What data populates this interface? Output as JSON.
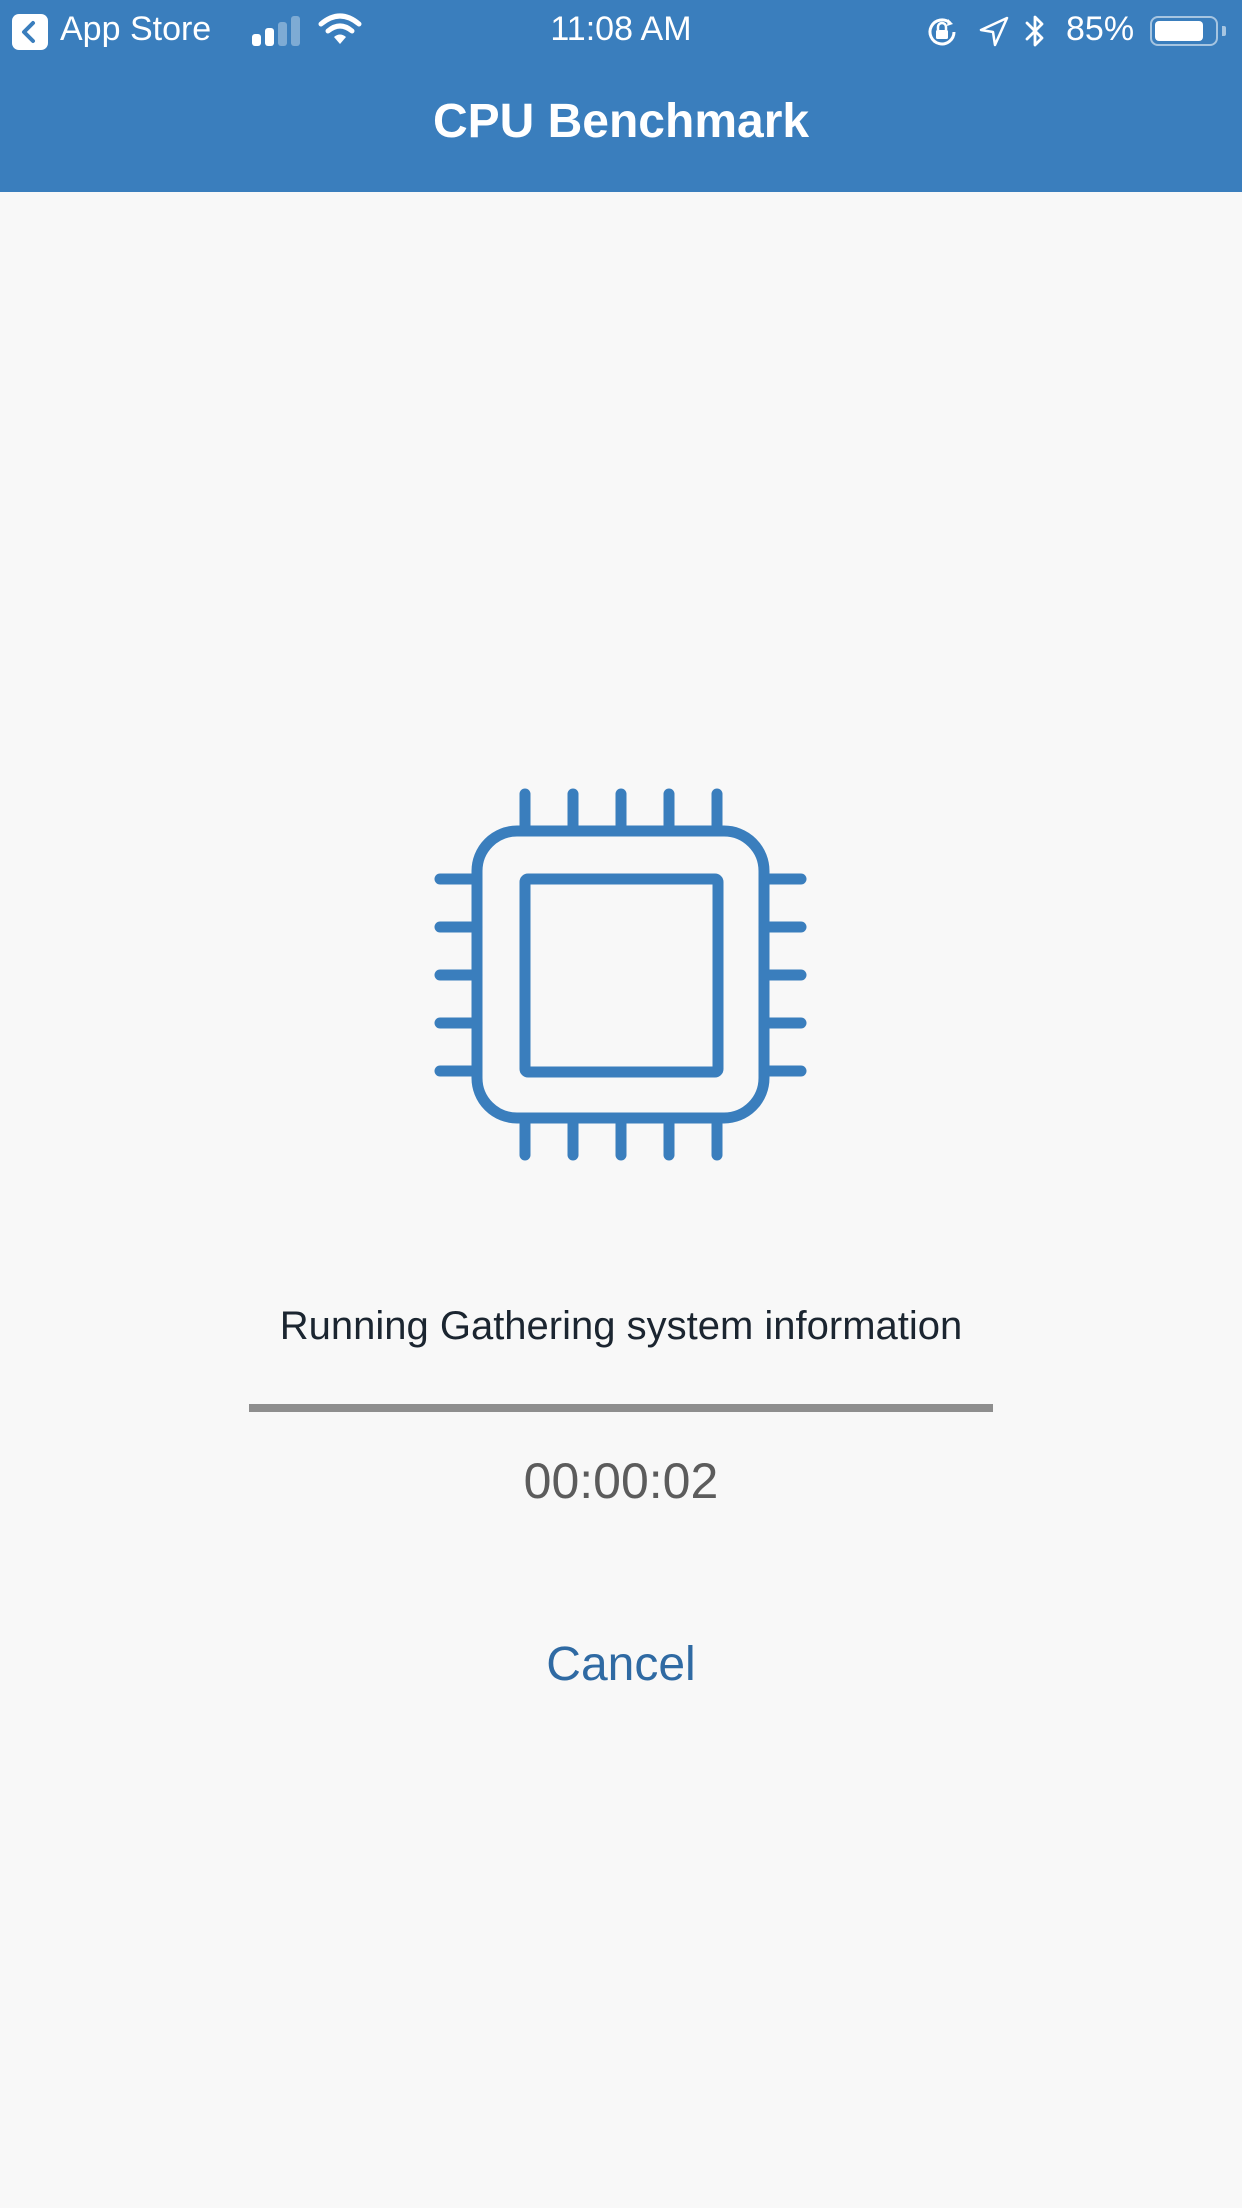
{
  "status_bar": {
    "back_app": "App Store",
    "time": "11:08 AM",
    "battery_percent": "85%",
    "battery_level": 0.85,
    "signal_bars_active": 2,
    "signal_bars_total": 4,
    "icons": [
      "back-arrow-icon",
      "signal-icon",
      "wifi-icon",
      "rotation-lock-icon",
      "location-icon",
      "bluetooth-icon",
      "battery-icon"
    ]
  },
  "nav": {
    "title": "CPU Benchmark"
  },
  "main": {
    "icon": "cpu-chip-icon",
    "status_text": "Running Gathering system information",
    "progress": 1.0,
    "elapsed": "00:00:02",
    "cancel_label": "Cancel"
  },
  "colors": {
    "brand": "#3a7ebd",
    "background": "#f8f8f8",
    "progress": "#8e8e8e",
    "link": "#2f6aa3"
  }
}
